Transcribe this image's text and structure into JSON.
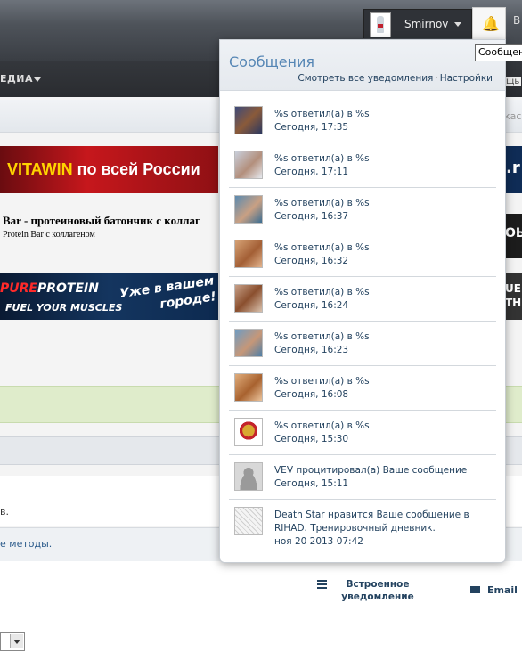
{
  "header": {
    "username": "Smirnov",
    "right_fragment": "B",
    "tooltip": "Сообщения"
  },
  "nav": {
    "item_fragment": "ЕДИА",
    "right_fragment": "щь",
    "crumb_right": "кас"
  },
  "banners": {
    "vitawin_brand": "VITAWIN",
    "vitawin_tail": " по всей России",
    "bar_title": "Bar - протеиновый батончик с коллаг",
    "bar_sub": "Protein Bar с коллагеном",
    "pp_brand_a": "PURE",
    "pp_brand_b": "PROTEIN",
    "pp_tagline": "FUEL YOUR MUSCLES",
    "pp_promo": "Уже в вашем городе!",
    "right1": ".r",
    "right2": "ОЬ",
    "right3": "UE TH"
  },
  "page": {
    "frag_v": "в.",
    "methods": "е методы.",
    "option_inline": "Встроенное уведомление",
    "option_email": "Email"
  },
  "popup": {
    "title": "Сообщения",
    "link_all": "Смотреть все уведомления",
    "link_sep": "·",
    "link_settings": "Настройки",
    "items": [
      {
        "msg": "%s ответил(а) в %s",
        "time": "Сегодня, 17:35"
      },
      {
        "msg": "%s ответил(а) в %s",
        "time": "Сегодня, 17:11"
      },
      {
        "msg": "%s ответил(а) в %s",
        "time": "Сегодня, 16:37"
      },
      {
        "msg": "%s ответил(а) в %s",
        "time": "Сегодня, 16:32"
      },
      {
        "msg": "%s ответил(а) в %s",
        "time": "Сегодня, 16:24"
      },
      {
        "msg": "%s ответил(а) в %s",
        "time": "Сегодня, 16:23"
      },
      {
        "msg": "%s ответил(а) в %s",
        "time": "Сегодня, 16:08"
      },
      {
        "msg": "%s ответил(а) в %s",
        "time": "Сегодня, 15:30"
      },
      {
        "msg": "VEV процитировал(а) Ваше сообщение",
        "time": "Сегодня, 15:11"
      },
      {
        "msg": "Death Star нравится Ваше сообщение в RIHAD. Тренировочный дневник.",
        "time": "ноя 20 2013 07:42"
      }
    ]
  },
  "colors": {
    "link": "#23425f",
    "popup_title": "#5686b5",
    "green_strip": "#dfeccb"
  }
}
